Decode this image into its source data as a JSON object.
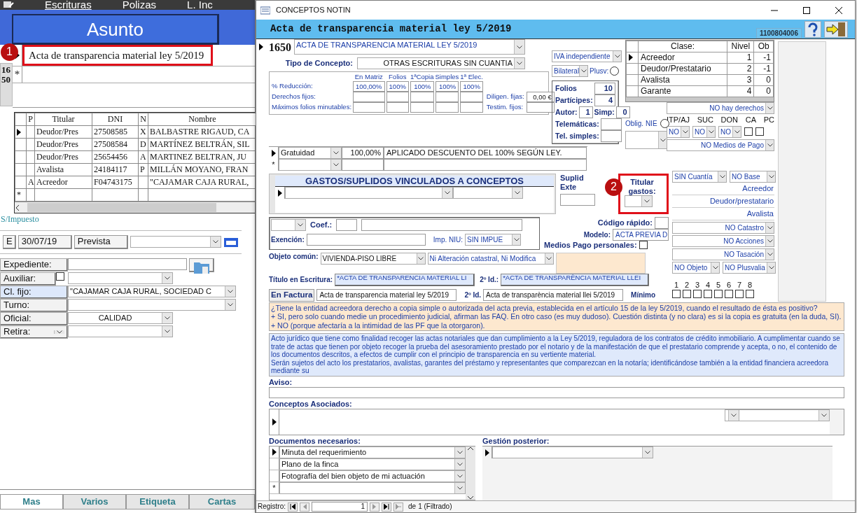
{
  "app": {
    "menu": [
      {
        "label": "Escrituras",
        "selected": true
      },
      {
        "label": "Polizas",
        "selected": false
      },
      {
        "label": "L. Inc",
        "selected": false
      }
    ],
    "asunto_button": "Asunto",
    "asunto": {
      "rows": [
        {
          "text": "Acta de transparencia material ley 5/2019",
          "current": true
        }
      ],
      "new_row_marker": "*",
      "record_number": "1650"
    },
    "parties": {
      "columns": [
        "P",
        "Titular",
        "DNI",
        "N",
        "Nombre"
      ],
      "rows": [
        {
          "titular": "Deudor/Pres",
          "dni": "27508585",
          "n": "X",
          "nombre": "BALBASTRE RIGAUD, CA",
          "current": true
        },
        {
          "titular": "Deudor/Pres",
          "dni": "27508584",
          "n": "D",
          "nombre": "MARTÍNEZ BELTRÁN, SIL",
          "current": false
        },
        {
          "titular": "Deudor/Pres",
          "dni": "25654456",
          "n": "A",
          "nombre": "MARTINEZ BELTRAN, JU",
          "current": false
        },
        {
          "titular": "Avalista",
          "dni": "24184117",
          "n": "P",
          "nombre": "MILLÁN MOYANO, FRAN",
          "current": false
        },
        {
          "p": "A",
          "titular": "Acreedor",
          "dni": "F04743175",
          "nombre": "\"CAJAMAR CAJA RURAL,",
          "current": false
        }
      ],
      "new_row_marker": "*"
    },
    "tax_link": "S/Impuesto",
    "date_row": {
      "code": "E",
      "date": "30/07/19",
      "status": "Prevista"
    },
    "fields": [
      {
        "label": "Expediente:",
        "kind": "text"
      },
      {
        "label": "Auxiliar:",
        "kind": "check-select",
        "checked": false
      },
      {
        "label": "Cl. fijo:",
        "kind": "select",
        "value": "\"CAJAMAR CAJA RURAL, SOCIEDAD C"
      },
      {
        "label": "Turno:",
        "kind": "select"
      },
      {
        "label": "Oficial:",
        "kind": "short-select",
        "value": "CALIDAD"
      },
      {
        "label": "Retira:",
        "kind": "label-select"
      }
    ],
    "tabs": [
      {
        "label": "Mas",
        "selected": true
      },
      {
        "label": "Varios",
        "selected": false
      },
      {
        "label": "Etiqueta",
        "selected": false
      },
      {
        "label": "Cartas",
        "selected": false
      }
    ]
  },
  "dialog": {
    "title": "CONCEPTOS NOTIN",
    "heading": "Acta de transparencia material ley 5/2019",
    "code": "1100804006",
    "number": "1650",
    "name": "ACTA DE TRANSPARENCIA MATERIAL LEY 5/2019",
    "type": {
      "label": "Tipo de Concepto:",
      "value": "OTRAS ESCRITURAS SIN CUANTIA"
    },
    "vat": "IVA independiente",
    "side": "Bilateral",
    "plusv": {
      "label": "Plusv:",
      "checked": false
    },
    "fees": {
      "columns": [
        "En Matriz",
        "Folios",
        "1ªCopia",
        "Simples",
        "1ª Elec."
      ],
      "rows": [
        {
          "label": "% Reducción:",
          "values": [
            "100,00%",
            "100%",
            "100%",
            "100%",
            "100%"
          ]
        },
        {
          "label": "Derechos fijos:"
        },
        {
          "label": "Máximos folios minutables:"
        }
      ]
    },
    "fixed": [
      {
        "label": "Diligen. fijas:",
        "value": "0,00 €"
      },
      {
        "label": "Testim. fijos:"
      }
    ],
    "counts": [
      {
        "items": [
          {
            "label": "Folios",
            "value": "10"
          }
        ]
      },
      {
        "items": [
          {
            "label": "Partícipes:",
            "value": "4"
          }
        ]
      },
      {
        "items": [
          {
            "label": "Autor:",
            "value": "1"
          },
          {
            "label": "Simp:",
            "value": "0"
          }
        ]
      },
      {
        "items": [
          {
            "label": "Telemáticas:"
          }
        ]
      },
      {
        "items": [
          {
            "label": "Tel. simples:"
          }
        ]
      }
    ],
    "discounts": {
      "rows": [
        {
          "type": "Gratuidad",
          "percent": "100,00%",
          "text": "APLICADO DESCUENTO DEL 100% SEGÚN LEY.",
          "current": true
        }
      ],
      "new_row_marker": "*"
    },
    "classes": {
      "columns": [
        "Clase:",
        "Nivel",
        "Ob"
      ],
      "rows": [
        {
          "name": "Acreedor",
          "nivel": "1",
          "ob": "-1",
          "current": true
        },
        {
          "name": "Deudor/Prestatario",
          "nivel": "2",
          "ob": "-1",
          "current": false
        },
        {
          "name": "Avalista",
          "nivel": "3",
          "ob": "0",
          "current": false
        },
        {
          "name": "Garante",
          "nivel": "4",
          "ob": "0",
          "current": false
        }
      ]
    },
    "nie": {
      "label": "Oblig. NIE",
      "checked": false
    },
    "options_top": {
      "rights": "NO hay derechos",
      "columns": [
        "ITP/AJ",
        "SUC",
        "DON",
        "CA",
        "PC"
      ],
      "selects": [
        "NO",
        "NO",
        "NO"
      ],
      "checks": [
        {
          "checked": false
        },
        {
          "checked": false
        }
      ],
      "payment": "NO Medios de Pago"
    },
    "gastos": {
      "title": "GASTOS/SUPLIDOS VINCULADOS A CONCEPTOS",
      "suplidos_labels": [
        "Suplid",
        "Exte"
      ],
      "titular_label": "Titular gastos:"
    },
    "quick_code_label": "Código rápido:",
    "model": {
      "label": "Modelo:",
      "value": "ACTA PREVIA D"
    },
    "coef_label": "Coef.:",
    "exemption_label": "Exención:",
    "niu": {
      "label": "Imp. NIU:",
      "value": "SIN IMPUE"
    },
    "medios_label": "Medios",
    "personal": {
      "label": "Pago personales:",
      "checked": false
    },
    "object": {
      "label": "Objeto común:",
      "value": "VIVIENDA-PISO LIBRE",
      "alteration": "Ni Alteración catastral, Ni Modifica"
    },
    "deed_title": {
      "label": "Título en Escritura:",
      "value": "*ACTA DE TRANSPARENCIA MATERIAL LI",
      "second_label": "2º Id.:",
      "second_value": "*ACTA DE TRANSPARÈNCIA MATERIAL LLEI"
    },
    "invoice": {
      "label": "En Factura",
      "value": "Acta de transparencia material ley 5/2019",
      "second_label": "2º Id.",
      "second_value": "Acta de transparència material llei 5/2019",
      "minimum_label": "Mínimo"
    },
    "options_bottom": {
      "amount": "SIN Cuantía",
      "base": "NO Base",
      "parties": [
        "Acreedor",
        "Deudor/prestatario",
        "Avalista"
      ],
      "selects": [
        "NO Catastro",
        "NO Acciones",
        "NO Tasación"
      ],
      "pair": [
        "NO Objeto",
        "NO Plusvalia"
      ],
      "numbers": [
        {
          "label": "1",
          "checked": false
        },
        {
          "label": "2",
          "checked": false
        },
        {
          "label": "3",
          "checked": false
        },
        {
          "label": "4",
          "checked": false
        },
        {
          "label": "5",
          "checked": false
        },
        {
          "label": "6",
          "checked": false
        },
        {
          "label": "7",
          "checked": false
        },
        {
          "label": "8",
          "checked": false
        }
      ]
    },
    "question": [
      "¿Tiene la entidad acreedora derecho a copia simple o autorizada del acta previa, establecida en el artículo 15 de la ley 5/2019, cuando el resultado de ésta es positivo?",
      "+ SI, pero solo cuando medie un procedimiento judicial, afirman las FAQ. En otro caso (es muy dudoso). Cuestión distinta (y no clara) es si la copia es gratuita (en la duda, SI).",
      "+ NO (porque afectaría a la intimidad de las PF que la otorgaron)."
    ],
    "description": [
      "Acto jurídico que tiene como finalidad recoger las actas notariales que dan cumplimiento a la Ley 5/2019, reguladora de los contratos de crédito inmobiliario. A cumplimentar cuando se trate de actas que tienen por objeto recoger la prueba del asesoramiento prestado por el notario y de la manifestación de que el prestatario comprende y acepta, o no, el contenido de los documentos descritos, a efectos de cumplir con el principio de transparencia en su vertiente material.",
      "Serán sujetos del acto los prestatarios, avalistas, garantes del préstamo y representantes que comparezcan en la notaría; identificándose también a la entidad financiera acreedora mediante su"
    ],
    "notice_label": "Aviso:",
    "related_label": "Conceptos Asociados:",
    "documents": {
      "label": "Documentos necesarios:",
      "rows": [
        {
          "text": "Minuta del requerimiento",
          "current": true
        },
        {
          "text": "Plano de la finca",
          "current": false
        },
        {
          "text": "Fotografía del bien objeto de mi actuación",
          "current": false
        }
      ],
      "new_row_marker": "*"
    },
    "followup_label": "Gestión posterior:",
    "navigator": {
      "label": "Registro:",
      "record": "1",
      "of": "de",
      "total": "1 (Filtrado)"
    }
  },
  "annotations": [
    {
      "label": "1"
    },
    {
      "label": "2"
    }
  ]
}
